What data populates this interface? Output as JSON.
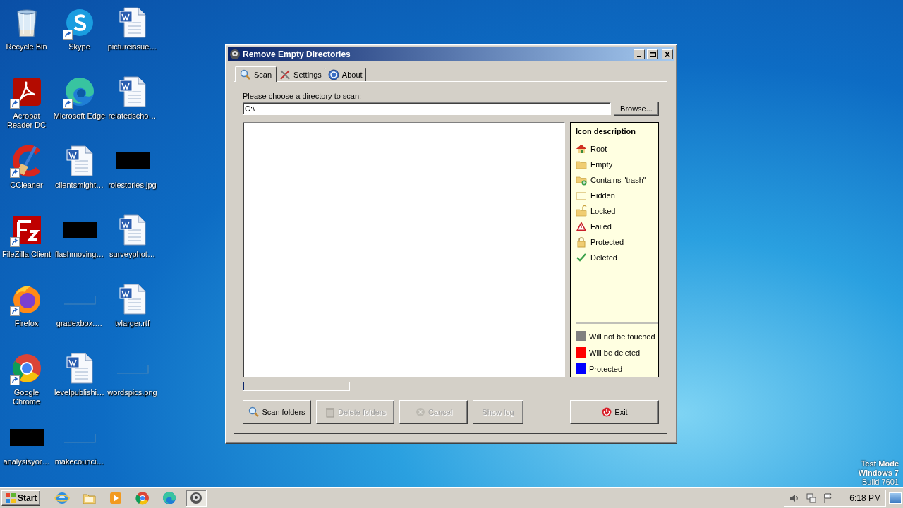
{
  "desktop_icons": [
    {
      "label": "Recycle Bin",
      "kind": "recycle",
      "shortcut": false
    },
    {
      "label": "Acrobat Reader DC",
      "kind": "acrobat",
      "shortcut": true
    },
    {
      "label": "CCleaner",
      "kind": "ccleaner",
      "shortcut": true
    },
    {
      "label": "FileZilla Client",
      "kind": "filezilla",
      "shortcut": true
    },
    {
      "label": "Firefox",
      "kind": "firefox",
      "shortcut": true
    },
    {
      "label": "Google Chrome",
      "kind": "chrome",
      "shortcut": true
    },
    {
      "label": "analysisyor…",
      "kind": "black",
      "shortcut": false
    },
    {
      "label": "Skype",
      "kind": "skype",
      "shortcut": true
    },
    {
      "label": "Microsoft Edge",
      "kind": "edge",
      "shortcut": true
    },
    {
      "label": "clientsmight…",
      "kind": "word",
      "shortcut": false
    },
    {
      "label": "flashmoving…",
      "kind": "black",
      "shortcut": false
    },
    {
      "label": "gradexbox.…",
      "kind": "blank",
      "shortcut": false
    },
    {
      "label": "levelpublishi…",
      "kind": "word",
      "shortcut": false
    },
    {
      "label": "makecounci…",
      "kind": "blank",
      "shortcut": false
    },
    {
      "label": "pictureissue…",
      "kind": "word",
      "shortcut": false
    },
    {
      "label": "relatedscho…",
      "kind": "word",
      "shortcut": false
    },
    {
      "label": "rolestories.jpg",
      "kind": "black",
      "shortcut": false
    },
    {
      "label": "surveyphot…",
      "kind": "word",
      "shortcut": false
    },
    {
      "label": "tvlarger.rtf",
      "kind": "word",
      "shortcut": false
    },
    {
      "label": "wordspics.png",
      "kind": "blank",
      "shortcut": false
    }
  ],
  "window": {
    "title": "Remove Empty Directories"
  },
  "tabs": [
    {
      "label": "Scan",
      "selected": true
    },
    {
      "label": "Settings",
      "selected": false
    },
    {
      "label": "About",
      "selected": false
    }
  ],
  "directory": {
    "label": "Please choose a directory to scan:",
    "value": "C:\\",
    "button": "Browse..."
  },
  "legend": {
    "title": "Icon description",
    "icons": [
      {
        "label": "Root",
        "kind": "root"
      },
      {
        "label": "Empty",
        "kind": "empty"
      },
      {
        "label": "Contains \"trash\"",
        "kind": "trash"
      },
      {
        "label": "Hidden",
        "kind": "hidden"
      },
      {
        "label": "Locked",
        "kind": "locked"
      },
      {
        "label": "Failed",
        "kind": "failed"
      },
      {
        "label": "Protected",
        "kind": "protected"
      },
      {
        "label": "Deleted",
        "kind": "deleted"
      }
    ],
    "colors": [
      {
        "label": "Will not be touched",
        "color": "#808080"
      },
      {
        "label": "Will be deleted",
        "color": "#ff0000"
      },
      {
        "label": "Protected",
        "color": "#0000ff"
      }
    ]
  },
  "progress": {
    "level": 0
  },
  "buttons": [
    {
      "label": "Scan folders",
      "disabled": false
    },
    {
      "label": "Delete folders",
      "disabled": true
    },
    {
      "label": "Cancel",
      "disabled": true
    },
    {
      "label": "Show log",
      "disabled": true
    }
  ],
  "exit_button": {
    "label": "Exit",
    "disabled": false
  },
  "taskbar": {
    "start": "Start",
    "items": [
      {
        "kind": "ie",
        "active": false
      },
      {
        "kind": "folder",
        "active": false
      },
      {
        "kind": "media",
        "active": false
      },
      {
        "kind": "chrome",
        "active": false
      },
      {
        "kind": "edge",
        "active": false
      },
      {
        "kind": "app",
        "active": true
      }
    ],
    "clock": "6:18 PM"
  },
  "os_notice": [
    "Test Mode",
    "Windows 7",
    "Build 7601"
  ]
}
